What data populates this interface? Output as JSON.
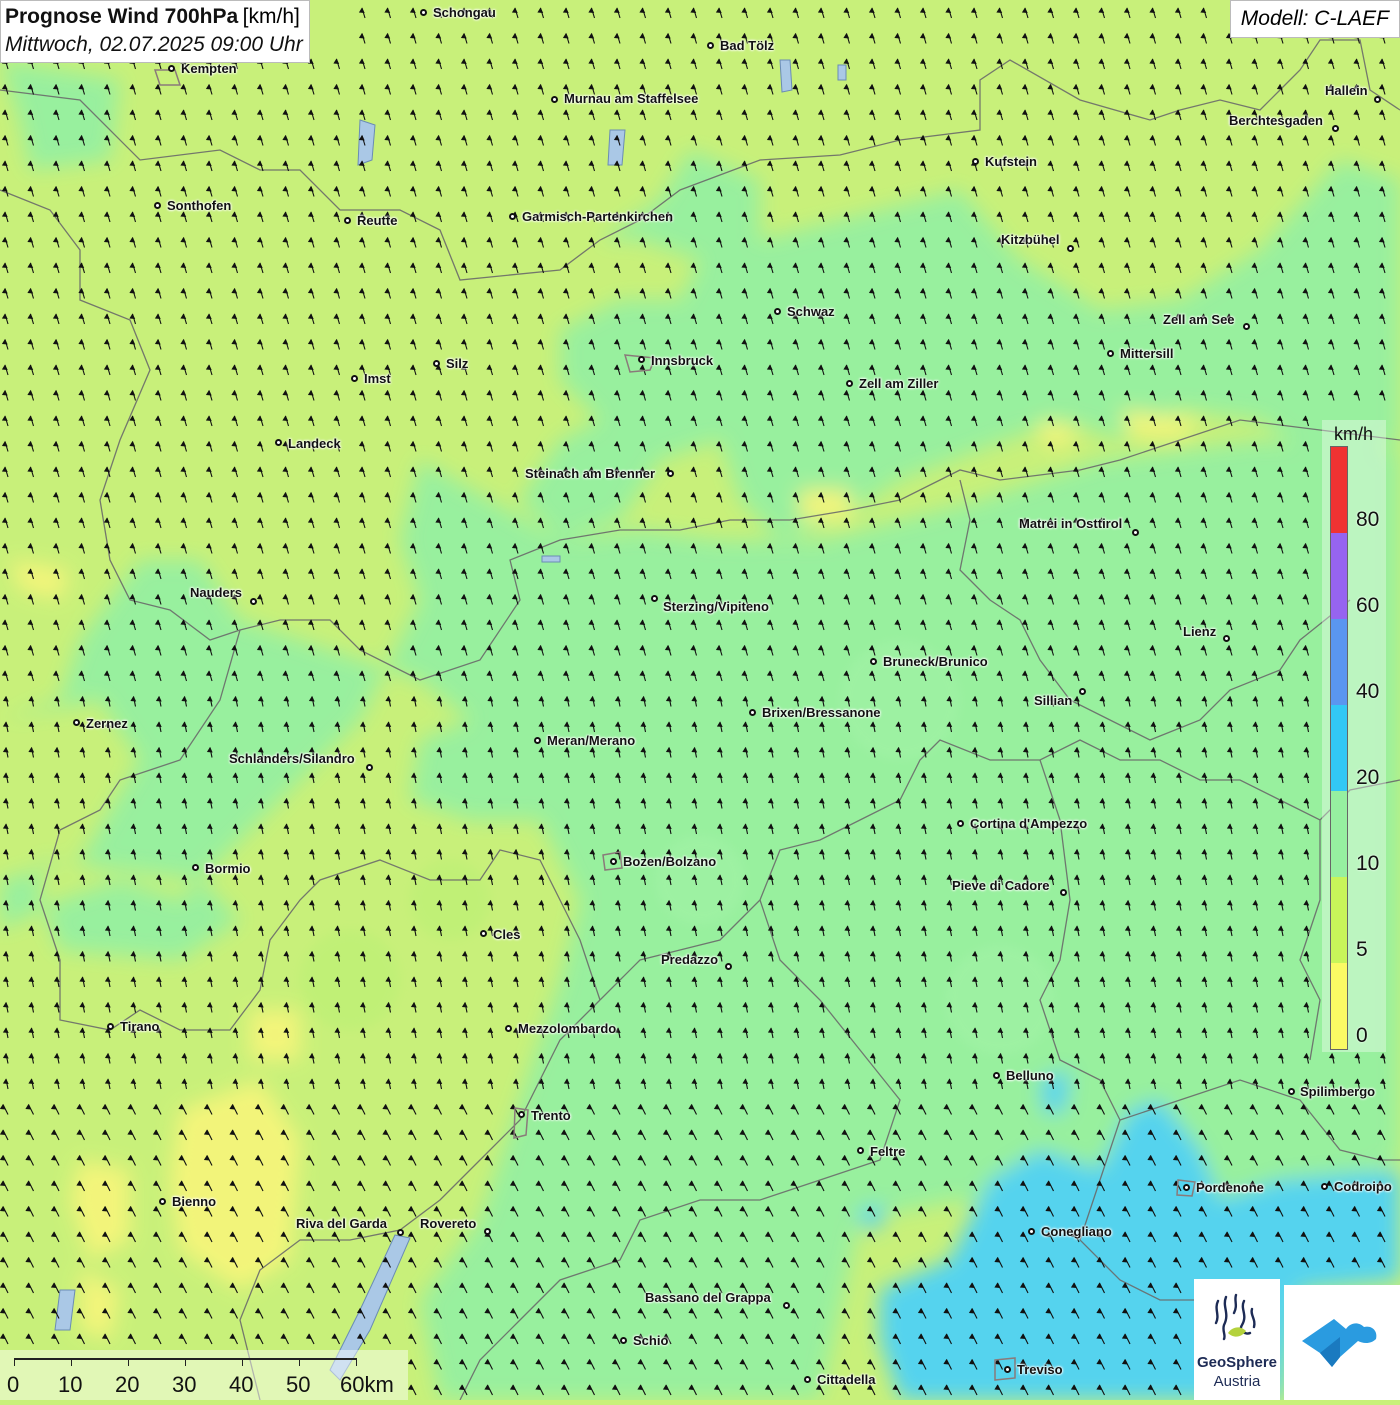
{
  "header": {
    "title_main": "Prognose Wind 700hPa",
    "title_unit": "[km/h]",
    "subtitle": "Mittwoch, 02.07.2025 09:00 Uhr",
    "model": "Modell: C-LAEF"
  },
  "colors": {
    "background_5_10": "#c8f07a",
    "zone_10_20": "#96f0a0",
    "zone_20_40": "#50d2f5",
    "zone_0_5": "#f5f57a",
    "border_line": "#666666",
    "arrow": "#111111"
  },
  "wind_arrows": {
    "direction": "north / north-north-west",
    "coverage": "regular grid across map"
  },
  "cities": [
    {
      "name": "Schongau"
    },
    {
      "name": "Bad Tölz"
    },
    {
      "name": "Kempten"
    },
    {
      "name": "Murnau am Staffelsee"
    },
    {
      "name": "Hallein"
    },
    {
      "name": "Berchtesgaden"
    },
    {
      "name": "Kufstein"
    },
    {
      "name": "Sonthofen"
    },
    {
      "name": "Reutte"
    },
    {
      "name": "Garmisch-Partenkirchen"
    },
    {
      "name": "Kitzbühel"
    },
    {
      "name": "Schwaz"
    },
    {
      "name": "Zell am See"
    },
    {
      "name": "Mittersill"
    },
    {
      "name": "Innsbruck"
    },
    {
      "name": "Silz"
    },
    {
      "name": "Imst"
    },
    {
      "name": "Zell am Ziller"
    },
    {
      "name": "Landeck"
    },
    {
      "name": "Steinach am Brenner"
    },
    {
      "name": "Matrei in Osttirol"
    },
    {
      "name": "Nauders"
    },
    {
      "name": "Sterzing/Vipiteno"
    },
    {
      "name": "Lienz"
    },
    {
      "name": "Bruneck/Brunico"
    },
    {
      "name": "Sillian"
    },
    {
      "name": "Brixen/Bressanone"
    },
    {
      "name": "Zernez"
    },
    {
      "name": "Meran/Merano"
    },
    {
      "name": "Schlanders/Silandro"
    },
    {
      "name": "Cortina d'Ampezzo"
    },
    {
      "name": "Bozen/Bolzano"
    },
    {
      "name": "Bormio"
    },
    {
      "name": "Pieve di Cadore"
    },
    {
      "name": "Cles"
    },
    {
      "name": "Predazzo"
    },
    {
      "name": "Tirano"
    },
    {
      "name": "Mezzolombardo"
    },
    {
      "name": "Belluno"
    },
    {
      "name": "Spilimbergo"
    },
    {
      "name": "Trento"
    },
    {
      "name": "Feltre"
    },
    {
      "name": "Pordenone"
    },
    {
      "name": "Codroipo"
    },
    {
      "name": "Bienno"
    },
    {
      "name": "Riva del Garda"
    },
    {
      "name": "Rovereto"
    },
    {
      "name": "Conegliano"
    },
    {
      "name": "Bassano del Grappa"
    },
    {
      "name": "Schio"
    },
    {
      "name": "Treviso"
    },
    {
      "name": "Cittadella"
    }
  ],
  "legend": {
    "unit": "km/h",
    "ticks": [
      "80",
      "60",
      "40",
      "20",
      "10",
      "5",
      "0"
    ],
    "segments": [
      {
        "from": 80,
        "color": "#f03232"
      },
      {
        "from": 60,
        "color": "#9664f0"
      },
      {
        "from": 40,
        "color": "#5a96f0"
      },
      {
        "from": 20,
        "color": "#32c8f5"
      },
      {
        "from": 10,
        "color": "#96f0a0"
      },
      {
        "from": 5,
        "color": "#c8f55a"
      },
      {
        "from": 0,
        "color": "#fafa64"
      }
    ]
  },
  "scale": {
    "labels": [
      "0",
      "10",
      "20",
      "30",
      "40",
      "50",
      "60km"
    ]
  },
  "logos": {
    "geosphere_line1": "GeoSphere",
    "geosphere_line2": "Austria"
  }
}
